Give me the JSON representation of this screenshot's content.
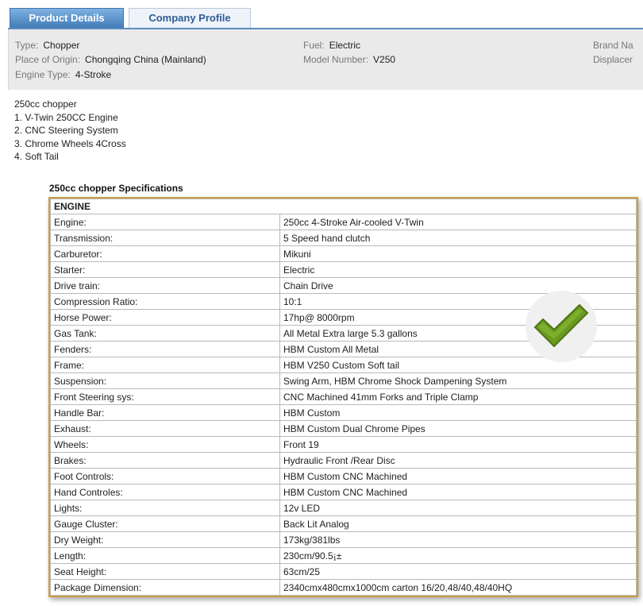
{
  "tabs": [
    {
      "label": "Product Details",
      "active": true
    },
    {
      "label": "Company Profile",
      "active": false
    }
  ],
  "attributes": {
    "type": {
      "key": "Type:",
      "value": "Chopper"
    },
    "origin": {
      "key": "Place of Origin:",
      "value": "Chongqing China (Mainland)"
    },
    "engine_type": {
      "key": "Engine Type:",
      "value": "4-Stroke"
    },
    "fuel": {
      "key": "Fuel:",
      "value": "Electric"
    },
    "model": {
      "key": "Model Number:",
      "value": "V250"
    },
    "brand": {
      "key": "Brand Na"
    },
    "displacement": {
      "key": "Displacer"
    }
  },
  "description": [
    "250cc chopper",
    "1. V-Twin 250CC Engine",
    "2. CNC Steering System",
    "3. Chrome Wheels 4Cross",
    "4. Soft Tail"
  ],
  "spec_title": "250cc chopper Specifications",
  "spec_section": "ENGINE",
  "specs": [
    {
      "key": "Engine:",
      "value": "250cc 4-Stroke Air-cooled V-Twin"
    },
    {
      "key": "Transmission:",
      "value": "5 Speed hand clutch"
    },
    {
      "key": "Carburetor:",
      "value": "Mikuni"
    },
    {
      "key": "Starter:",
      "value": "Electric"
    },
    {
      "key": "Drive train:",
      "value": "Chain Drive"
    },
    {
      "key": "Compression Ratio:",
      "value": "10:1"
    },
    {
      "key": "Horse Power:",
      "value": "17hp@ 8000rpm"
    },
    {
      "key": "Gas Tank:",
      "value": "All Metal Extra large 5.3 gallons"
    },
    {
      "key": "Fenders:",
      "value": "HBM Custom All Metal"
    },
    {
      "key": "Frame:",
      "value": "HBM V250 Custom Soft tail"
    },
    {
      "key": "Suspension:",
      "value": "Swing Arm, HBM Chrome Shock Dampening System"
    },
    {
      "key": "Front Steering sys:",
      "value": "CNC Machined 41mm Forks and Triple Clamp"
    },
    {
      "key": "Handle Bar:",
      "value": "HBM Custom"
    },
    {
      "key": "Exhaust:",
      "value": "HBM Custom Dual Chrome Pipes"
    },
    {
      "key": "Wheels:",
      "value": "Front 19"
    },
    {
      "key": "Brakes:",
      "value": "Hydraulic Front /Rear Disc"
    },
    {
      "key": "Foot Controls:",
      "value": "HBM Custom CNC Machined"
    },
    {
      "key": "Hand Controles:",
      "value": "HBM Custom CNC Machined"
    },
    {
      "key": "Lights:",
      "value": "12v LED"
    },
    {
      "key": "Gauge Cluster:",
      "value": "Back Lit Analog"
    },
    {
      "key": "Dry Weight:",
      "value": "173kg/381lbs"
    },
    {
      "key": "Length:",
      "value": "230cm/90.5¡±"
    },
    {
      "key": "Seat Height:",
      "value": "63cm/25"
    },
    {
      "key": "Package Dimension:",
      "value": "2340cmx480cmx1000cm carton 16/20,48/40,48/40HQ"
    }
  ],
  "badge": {
    "icon": "checkmark-icon",
    "color": "#6a9a1f"
  }
}
